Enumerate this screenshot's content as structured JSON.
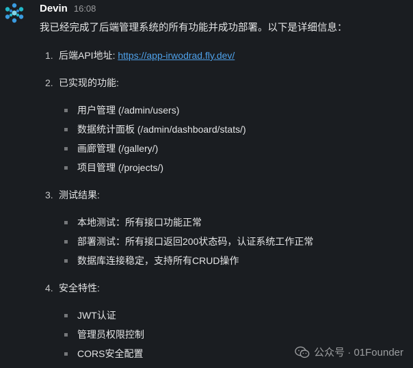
{
  "message": {
    "author": "Devin",
    "time": "16:08",
    "intro": "我已经完成了后端管理系统的所有功能并成功部署。以下是详细信息：",
    "sections": [
      {
        "num": "1.",
        "label": "后端API地址: ",
        "link": "https://app-irwodrad.fly.dev/"
      },
      {
        "num": "2.",
        "label": "已实现的功能:",
        "items": [
          "用户管理 (/admin/users)",
          "数据统计面板 (/admin/dashboard/stats/)",
          "画廊管理 (/gallery/)",
          "项目管理 (/projects/)"
        ]
      },
      {
        "num": "3.",
        "label": "测试结果:",
        "items": [
          "本地测试：所有接口功能正常",
          "部署测试：所有接口返回200状态码，认证系统工作正常",
          "数据库连接稳定，支持所有CRUD操作"
        ]
      },
      {
        "num": "4.",
        "label": "安全特性:",
        "items": [
          "JWT认证",
          "管理员权限控制",
          "CORS安全配置"
        ]
      }
    ]
  },
  "watermark": {
    "text": "公众号 · 01Founder",
    "icon": "wechat-icon"
  },
  "colors": {
    "background": "#1a1d21",
    "link": "#4ea1ea",
    "avatar_blue": "#3a9be0",
    "avatar_teal": "#22b8c9"
  }
}
